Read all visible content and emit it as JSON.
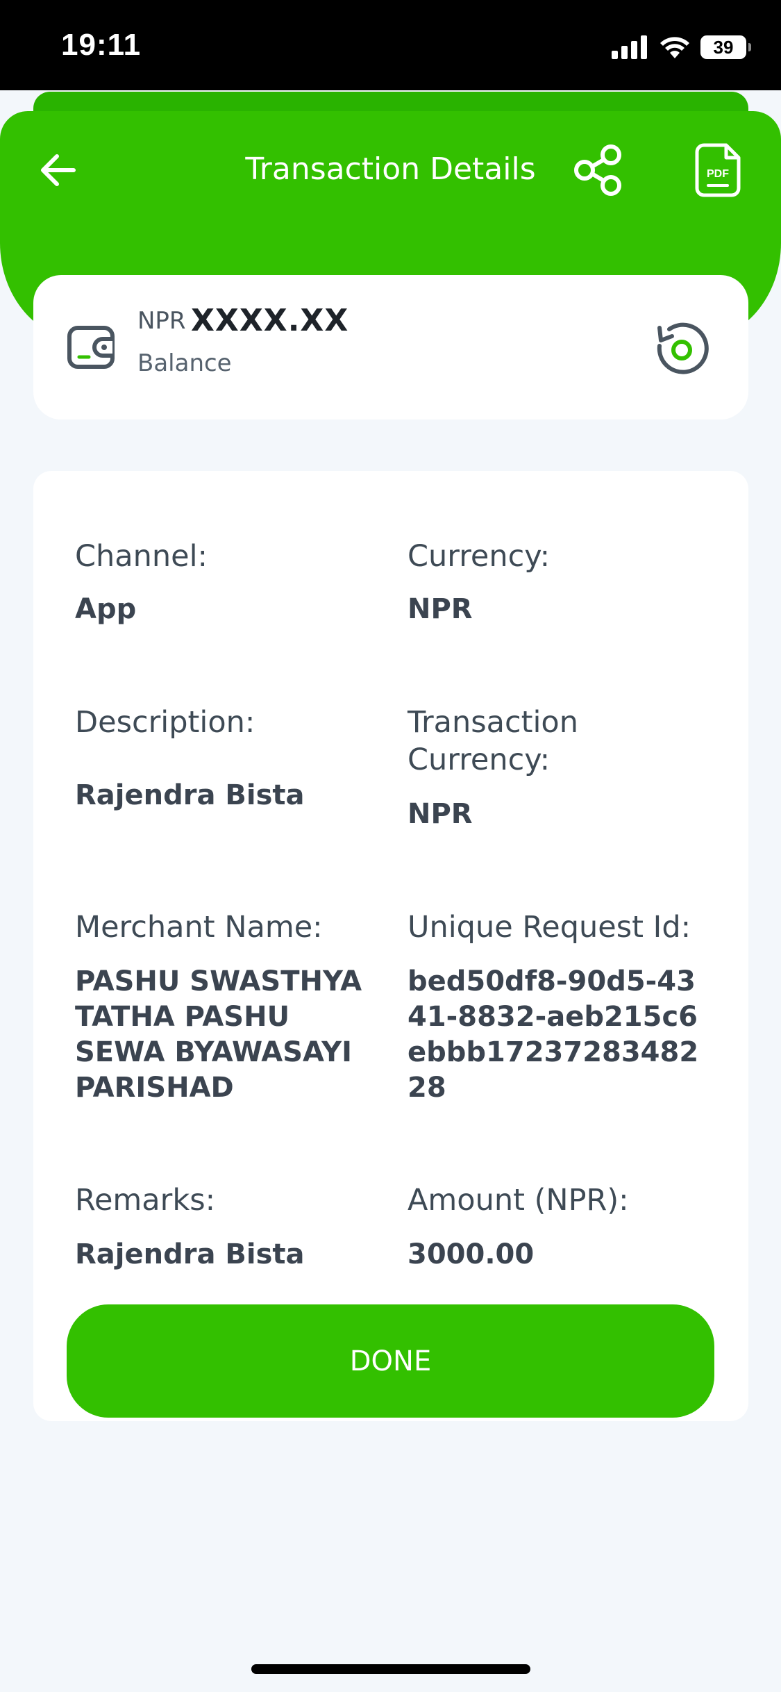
{
  "status_bar": {
    "time": "19:11",
    "battery": "39"
  },
  "header": {
    "title": "Transaction Details",
    "back_icon": "arrow-left-icon",
    "share_icon": "share-icon",
    "pdf_icon": "pdf-icon",
    "pdf_icon_text": "PDF"
  },
  "balance": {
    "currency": "NPR",
    "amount": "XXXX.XX",
    "label": "Balance",
    "wallet_icon": "wallet-icon",
    "refresh_icon": "refresh-icon"
  },
  "details": {
    "channel": {
      "label": "Channel:",
      "value": "App"
    },
    "currency": {
      "label": "Currency:",
      "value": "NPR"
    },
    "description": {
      "label": "Description:",
      "value": "Rajendra Bista"
    },
    "transaction_currency": {
      "label": "Transaction Currency:",
      "value": "NPR"
    },
    "merchant_name": {
      "label": "Merchant Name:",
      "value": "PASHU SWASTHYA TATHA PASHU SEWA BYAWASAYI PARISHAD"
    },
    "unique_request_id": {
      "label": "Unique Request Id:",
      "value": "bed50df8-90d5-4341-8832-aeb215c6ebbb1723728348228"
    },
    "remarks": {
      "label": "Remarks:",
      "value": "Rajendra Bista"
    },
    "amount": {
      "label": "Amount (NPR):",
      "value": "3000.00"
    }
  },
  "done_button": {
    "label": "DONE"
  },
  "colors": {
    "brand_green": "#33c000",
    "background": "#f3f7fb",
    "text_dark": "#3b4450"
  }
}
